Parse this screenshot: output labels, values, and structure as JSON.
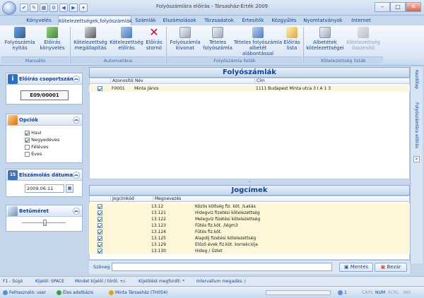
{
  "window": {
    "title": "Folyószámlára előírás - Társasház-Érték 2009",
    "min": "–",
    "max": "□",
    "close": "✕",
    "quick_access": [
      "✔",
      "✎",
      "▦",
      "⚙",
      "◀",
      "▶",
      "▾"
    ]
  },
  "tabs": [
    "Könyvelés",
    "Kötelezettségek,folyószámlák",
    "Számlák",
    "Elszámolások",
    "Törzsadatok",
    "Értesítők",
    "Közgyűlés",
    "Nyomtatványok",
    "Internet"
  ],
  "ribbon": {
    "groups": [
      {
        "label": "Manuális",
        "buttons": [
          {
            "line1": "Folyószámla",
            "line2": "nyitás"
          },
          {
            "line1": "Előírás",
            "line2": "könyvelés"
          }
        ]
      },
      {
        "label": "Automatikus",
        "buttons": [
          {
            "line1": "Kötelezettség",
            "line2": "megállapítás"
          },
          {
            "line1": "Kötelezettség",
            "line2": "előírás"
          },
          {
            "line1": "Előírás",
            "line2": "stornó"
          }
        ]
      },
      {
        "label": "Folyószámla listák",
        "buttons": [
          {
            "line1": "Folyószámla",
            "line2": "kivonat"
          },
          {
            "line1": "Tételes",
            "line2": "folyószámla"
          },
          {
            "line1": "Tételes folyószámla",
            "line2": "albetét alábontással"
          },
          {
            "line1": "Előírás",
            "line2": "lista"
          }
        ]
      },
      {
        "label": "Kötelezettség listák",
        "buttons": [
          {
            "line1": "Albetétek",
            "line2": "kötelezettségei"
          },
          {
            "line1": "Kötelezettség",
            "line2": "összesítő"
          }
        ]
      }
    ]
  },
  "panels": {
    "group_number": {
      "title": "Előírás csoportszáma",
      "value": "E09/00001"
    },
    "options": {
      "title": "Opciók",
      "items": [
        {
          "label": "Havi",
          "checked": true
        },
        {
          "label": "Negyedéves",
          "checked": true
        },
        {
          "label": "Féléves",
          "checked": false
        },
        {
          "label": "Éves",
          "checked": false
        }
      ]
    },
    "date": {
      "title": "Elszámolás dátuma",
      "value": "2009.06.11"
    },
    "font": {
      "title": "Betűméret"
    }
  },
  "accounts": {
    "title": "Folyószámlák",
    "columns": [
      "Azonosító",
      "Név",
      "Cím"
    ],
    "rows": [
      {
        "id": "F0001",
        "name": "Minta János",
        "address": "1111 Budapest Minta utca 3 I A 1 3"
      }
    ]
  },
  "titles": {
    "title": "Jogcímek",
    "columns": [
      "Jogcímkód",
      "Megnevezés"
    ],
    "rows": [
      {
        "code": "13.12",
        "name": "Közös költség fiz. köt. /Lakás"
      },
      {
        "code": "13.121",
        "name": "Hidegvíz fizetési kötelezettség"
      },
      {
        "code": "13.122",
        "name": "Melegvíz fizetési kötelezettség"
      },
      {
        "code": "13.123",
        "name": "Fűtés fiz.köt. /légm3"
      },
      {
        "code": "13.124",
        "name": "Fűtés fiz.köt."
      },
      {
        "code": "13.125",
        "name": "Alapdíj fizetési kötelezettség"
      },
      {
        "code": "13.129",
        "name": "Előző évek fiz.köt. korrekciója"
      },
      {
        "code": "13.130",
        "name": "Hideg / Üzlet"
      }
    ]
  },
  "find": {
    "label": "Szöveg",
    "value": ""
  },
  "buttons": {
    "save": "Mentés",
    "close": "Bezár"
  },
  "right_strip": {
    "tab1": "Kezdőlap",
    "tab2": "Folyószámlára előírás"
  },
  "keys_bar": [
    "F1 - Súgó",
    "Kijelöl: SPACE",
    "Mindet kijelöl / töröl: +/-",
    "Kijelölést megfordít: *",
    "Intervallum megadás: /"
  ],
  "status": {
    "user": "Felhasználó: user",
    "db": "Éles adatbázis",
    "house": "Minta Társasház (TH054)",
    "count": "1",
    "caps": "CAPS",
    "num": "NUM",
    "scrl": "SCRL",
    "ins": "INS"
  },
  "colors": {
    "accent": "#15428b",
    "ribbon_bg": "#dbe7f5",
    "selected_row": "#fdf6d8"
  }
}
